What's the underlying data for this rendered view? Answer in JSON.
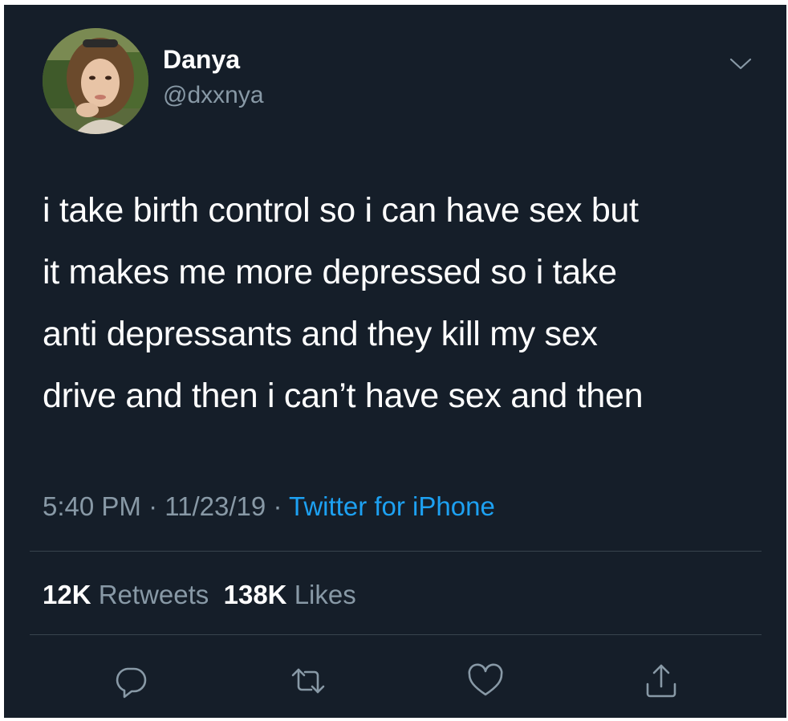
{
  "user": {
    "display_name": "Danya",
    "handle": "@dxxnya"
  },
  "tweet": {
    "lines": [
      "i take birth control so i can have sex but",
      "it makes me more depressed so i take",
      "anti depressants and they kill my sex",
      "drive and then i can’t have sex and then"
    ],
    "time": "5:40 PM",
    "separator": "·",
    "date": "11/23/19",
    "source": "Twitter for iPhone"
  },
  "stats": {
    "retweets_count": "12K",
    "retweets_label": "Retweets",
    "likes_count": "138K",
    "likes_label": "Likes"
  },
  "actions": [
    {
      "icon": "reply-icon"
    },
    {
      "icon": "retweet-icon"
    },
    {
      "icon": "like-icon"
    },
    {
      "icon": "share-icon"
    }
  ],
  "colors": {
    "background": "#151e29",
    "text": "#ffffff",
    "secondary": "#8899a6",
    "link": "#1da1f2",
    "divider": "#38444d"
  }
}
